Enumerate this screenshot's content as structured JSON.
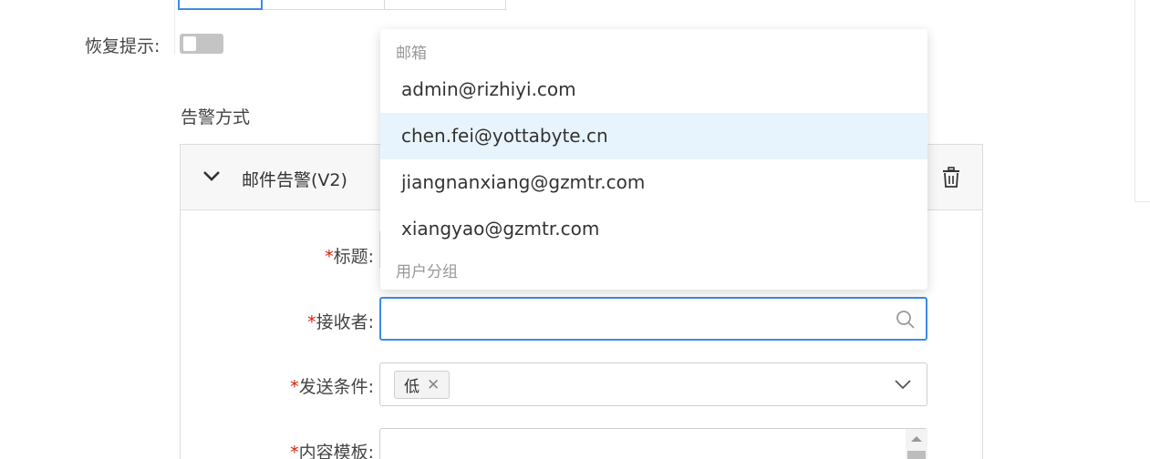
{
  "recover": {
    "label": "恢复提示:",
    "enabled": false
  },
  "alert_section": {
    "title": "告警方式"
  },
  "alert_card": {
    "title": "邮件告警(V2)"
  },
  "form": {
    "required_mark": "*",
    "title_label": "标题:",
    "receiver_label": "接收者:",
    "receiver_value": "",
    "condition_label": "发送条件:",
    "condition_tags": [
      "低"
    ],
    "template_label": "内容模板:"
  },
  "dropdown": {
    "email_group": "邮箱",
    "options": [
      "admin@rizhiyi.com",
      "chen.fei@yottabyte.cn",
      "jiangnanxiang@gzmtr.com",
      "xiangyao@gzmtr.com"
    ],
    "highlighted_index": 1,
    "user_group": "用户分组"
  },
  "colors": {
    "accent": "#3c8ae8",
    "required": "#d81e06",
    "highlight": "#e8f4fd"
  },
  "icons": [
    "chevron-down-icon",
    "trash-icon",
    "search-icon",
    "close-icon"
  ]
}
